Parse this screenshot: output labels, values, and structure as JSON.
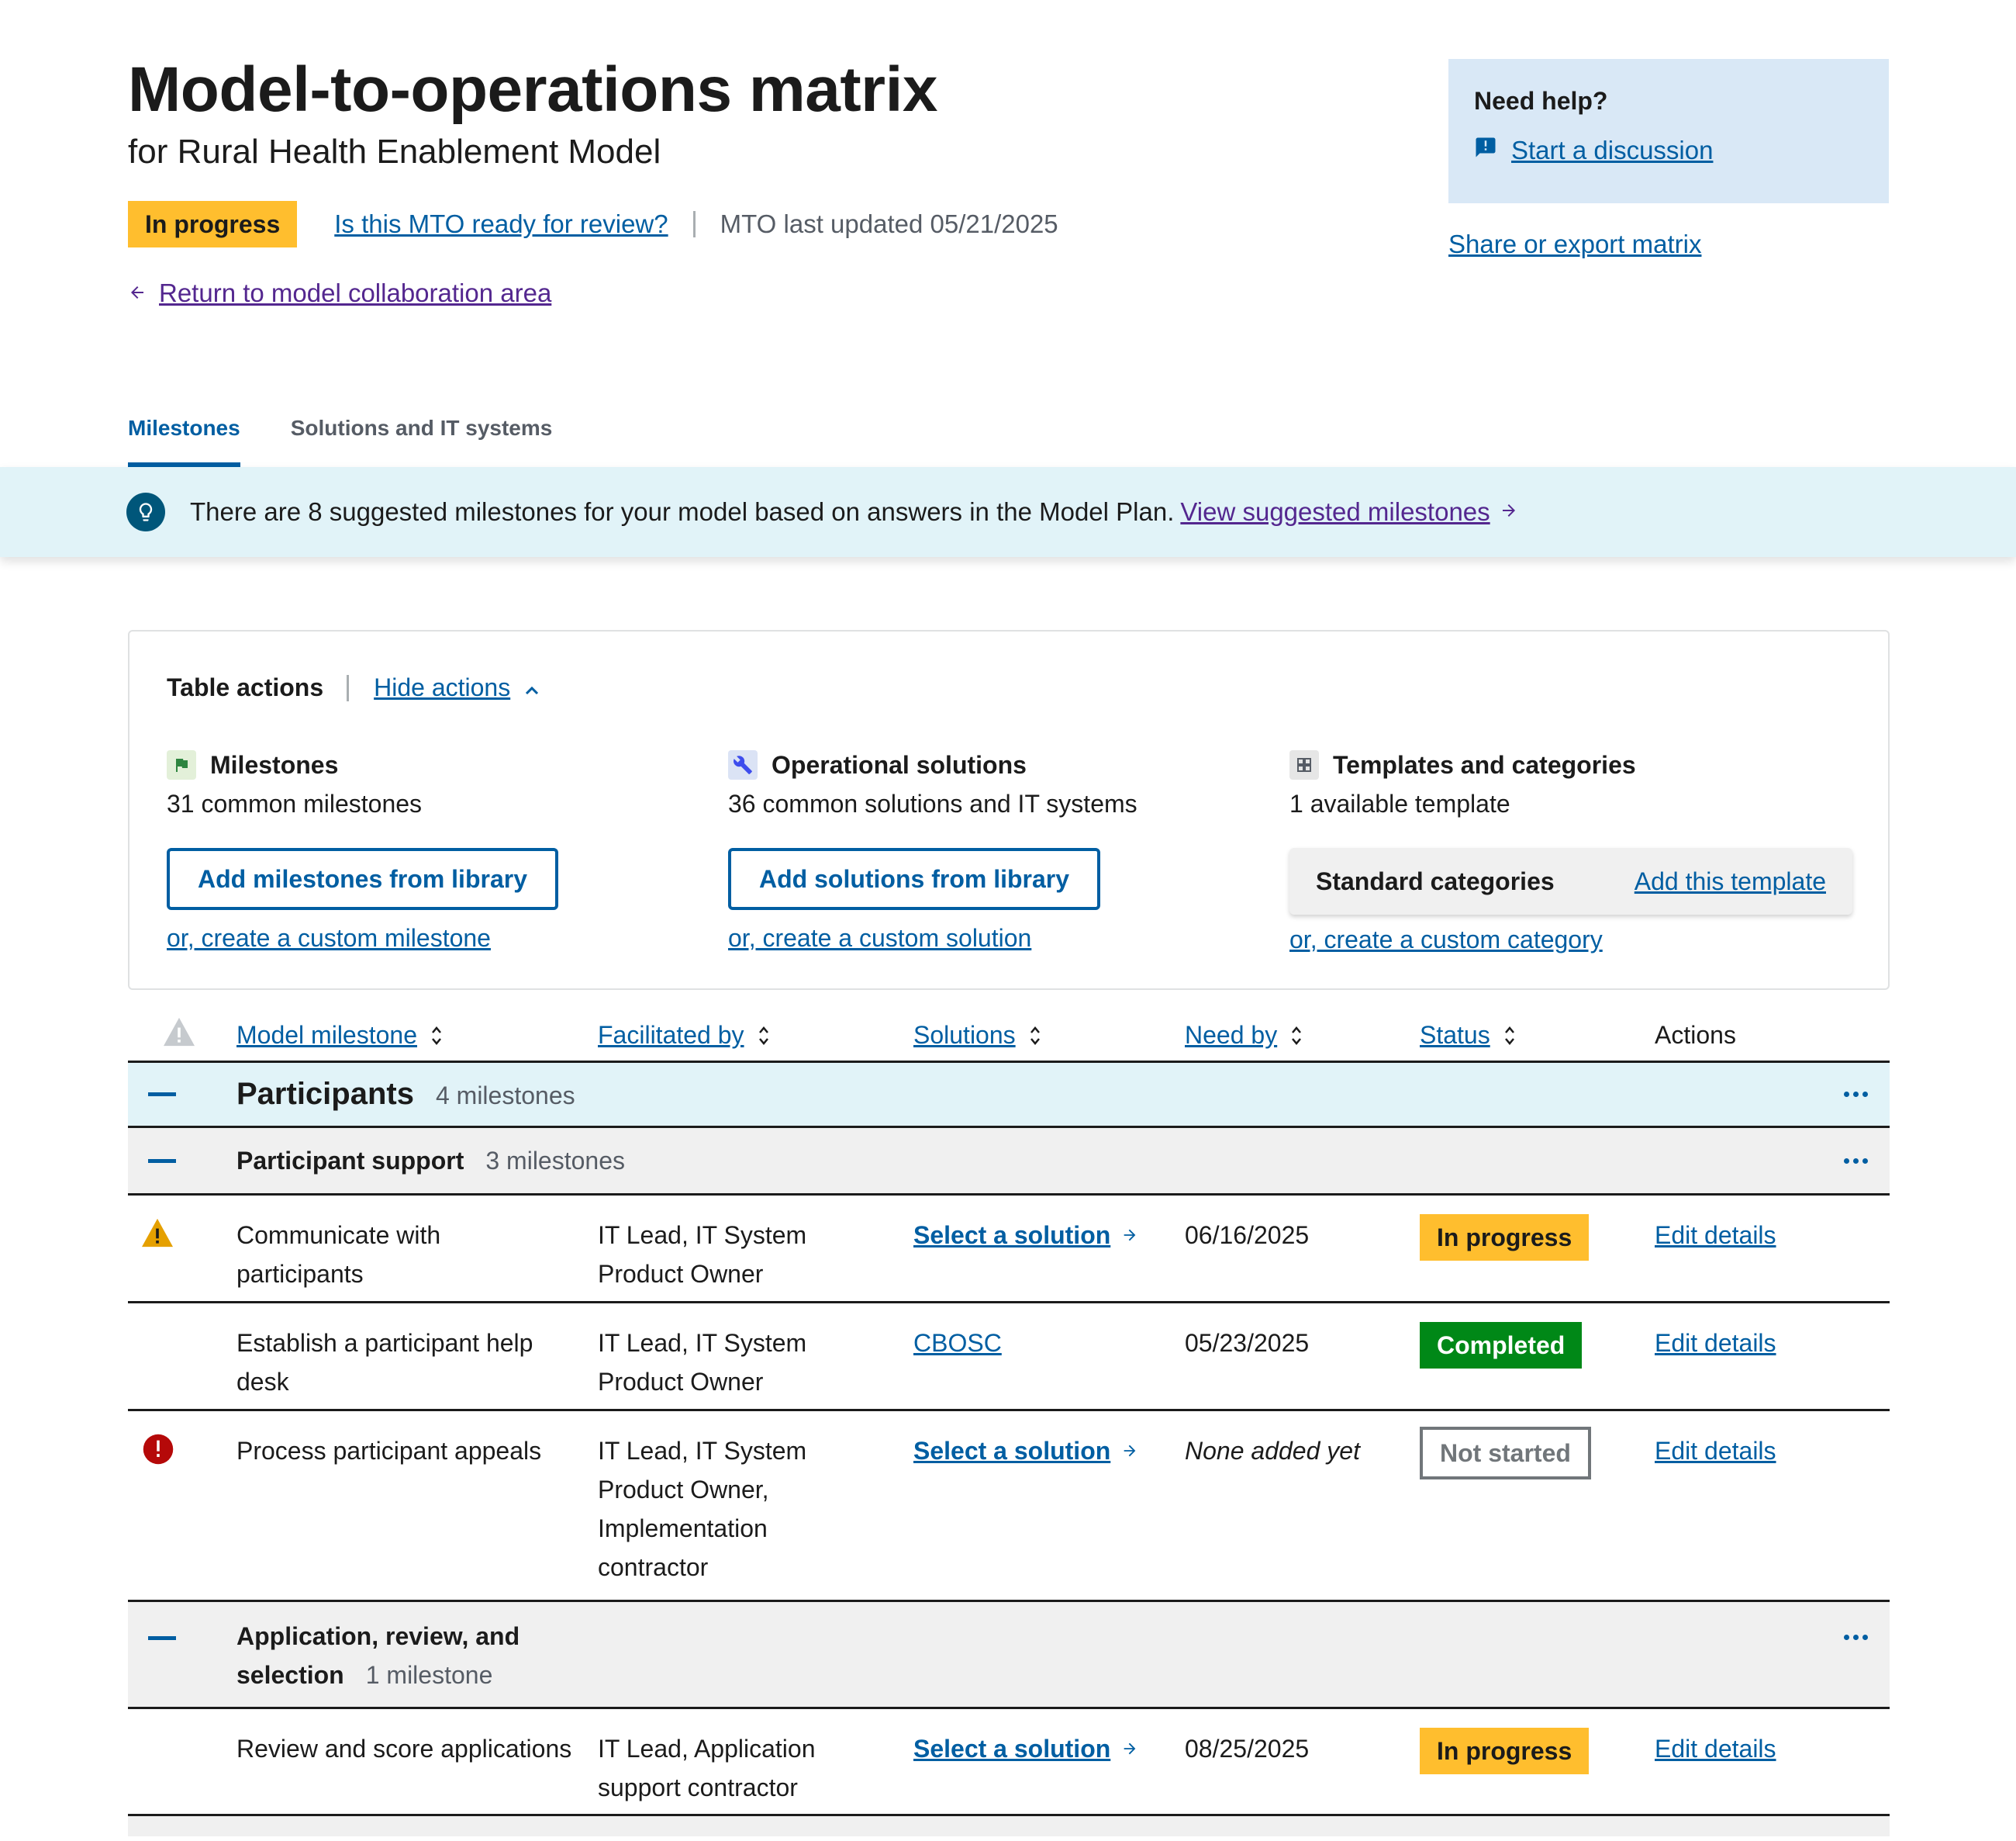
{
  "header": {
    "title": "Model-to-operations matrix",
    "subtitle": "for Rural Health Enablement Model",
    "status": "In progress",
    "review_link": "Is this MTO ready for review?",
    "updated": "MTO last updated 05/21/2025",
    "return_link": "Return to model collaboration area"
  },
  "help": {
    "title": "Need help?",
    "discussion_link": "Start a discussion",
    "share_link": "Share or export matrix"
  },
  "tabs": [
    {
      "label": "Milestones",
      "active": true
    },
    {
      "label": "Solutions and IT systems",
      "active": false
    }
  ],
  "suggestion": {
    "text": "There are 8 suggested milestones for your model based on answers in the Model Plan.",
    "link": "View suggested milestones"
  },
  "table_actions": {
    "title": "Table actions",
    "hide_link": "Hide actions",
    "milestones": {
      "title": "Milestones",
      "desc": "31 common milestones",
      "button": "Add milestones from library",
      "link": "or, create a custom milestone"
    },
    "solutions": {
      "title": "Operational solutions",
      "desc": "36 common solutions and IT systems",
      "button": "Add solutions from library",
      "link": "or, create a custom solution"
    },
    "templates": {
      "title": "Templates and categories",
      "desc": "1 available template",
      "template_name": "Standard categories",
      "template_link": "Add this template",
      "link": "or, create a custom category"
    }
  },
  "table": {
    "columns": [
      "Model milestone",
      "Facilitated by",
      "Solutions",
      "Need by",
      "Status",
      "Actions"
    ],
    "category": {
      "name": "Participants",
      "count": "4 milestones"
    },
    "subcategories": [
      {
        "name": "Participant support",
        "count": "3 milestones",
        "rows": [
          {
            "alert": "warning",
            "milestone_lines": [
              "Communicate with",
              "participants"
            ],
            "facilitated_lines": [
              "IT Lead, IT System",
              "Product Owner"
            ],
            "solution": "Select a solution",
            "solution_type": "select",
            "need_by": "06/16/2025",
            "status": "In progress",
            "action": "Edit details"
          },
          {
            "alert": "none",
            "milestone_lines": [
              "Establish a participant help",
              "desk"
            ],
            "facilitated_lines": [
              "IT Lead, IT System",
              "Product Owner"
            ],
            "solution": "CBOSC",
            "solution_type": "link",
            "need_by": "05/23/2025",
            "status": "Completed",
            "action": "Edit details"
          },
          {
            "alert": "error",
            "milestone_lines": [
              "Process participant appeals"
            ],
            "facilitated_lines": [
              "IT Lead, IT System",
              "Product Owner,",
              "Implementation",
              "contractor"
            ],
            "solution": "Select a solution",
            "solution_type": "select",
            "need_by": "None added yet",
            "status": "Not started",
            "action": "Edit details"
          }
        ]
      },
      {
        "name_lines": [
          "Application, review, and",
          "selection"
        ],
        "count": "1 milestone",
        "rows": [
          {
            "alert": "none",
            "milestone_lines": [
              "Review and score applications"
            ],
            "facilitated_lines": [
              "IT Lead, Application",
              "support contractor"
            ],
            "solution": "Select a solution",
            "solution_type": "select",
            "need_by": "08/25/2025",
            "status": "In progress",
            "action": "Edit details"
          }
        ]
      }
    ]
  },
  "colors": {
    "primary": "#005ea2",
    "visited": "#54278f",
    "in_progress": "#ffbe2e",
    "completed": "#008817",
    "warning": "#e5a000",
    "error": "#b50909"
  }
}
